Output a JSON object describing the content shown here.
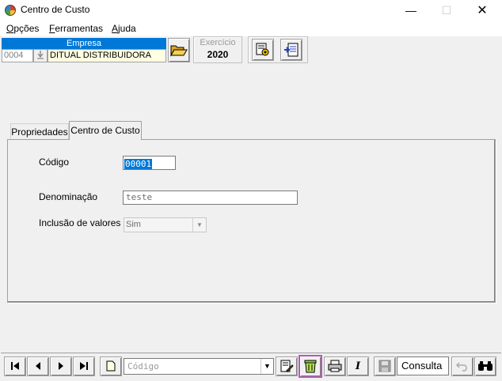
{
  "window": {
    "title": "Centro de Custo",
    "min_glyph": "—",
    "max_glyph": "☐",
    "close_glyph": "✕"
  },
  "menu": {
    "items": [
      {
        "label": "Opções",
        "accel": "O",
        "rest": "pções"
      },
      {
        "label": "Ferramentas",
        "accel": "F",
        "rest": "erramentas"
      },
      {
        "label": "Ajuda",
        "accel": "A",
        "rest": "juda"
      }
    ]
  },
  "empresa": {
    "header": "Empresa",
    "code": "0004",
    "name": "DITUAL DISTRIBUIDORA"
  },
  "exercicio": {
    "label": "Exercício",
    "value": "2020"
  },
  "tabs": [
    {
      "label": "Propriedades",
      "active": false
    },
    {
      "label": "Centro de Custo",
      "active": true
    }
  ],
  "form": {
    "codigo_label": "Código",
    "codigo_value": "00001",
    "denominacao_label": "Denominação",
    "denominacao_value": "teste",
    "inclusao_label": "Inclusão de valores ?",
    "inclusao_value": "Sim"
  },
  "toolbar": {
    "search_placeholder": "Código",
    "mode": "Consulta",
    "italic_glyph": "I"
  },
  "colors": {
    "accent": "#0078d7",
    "highlight_border": "#b15bb5",
    "empresa_bg": "#ffffe1"
  }
}
